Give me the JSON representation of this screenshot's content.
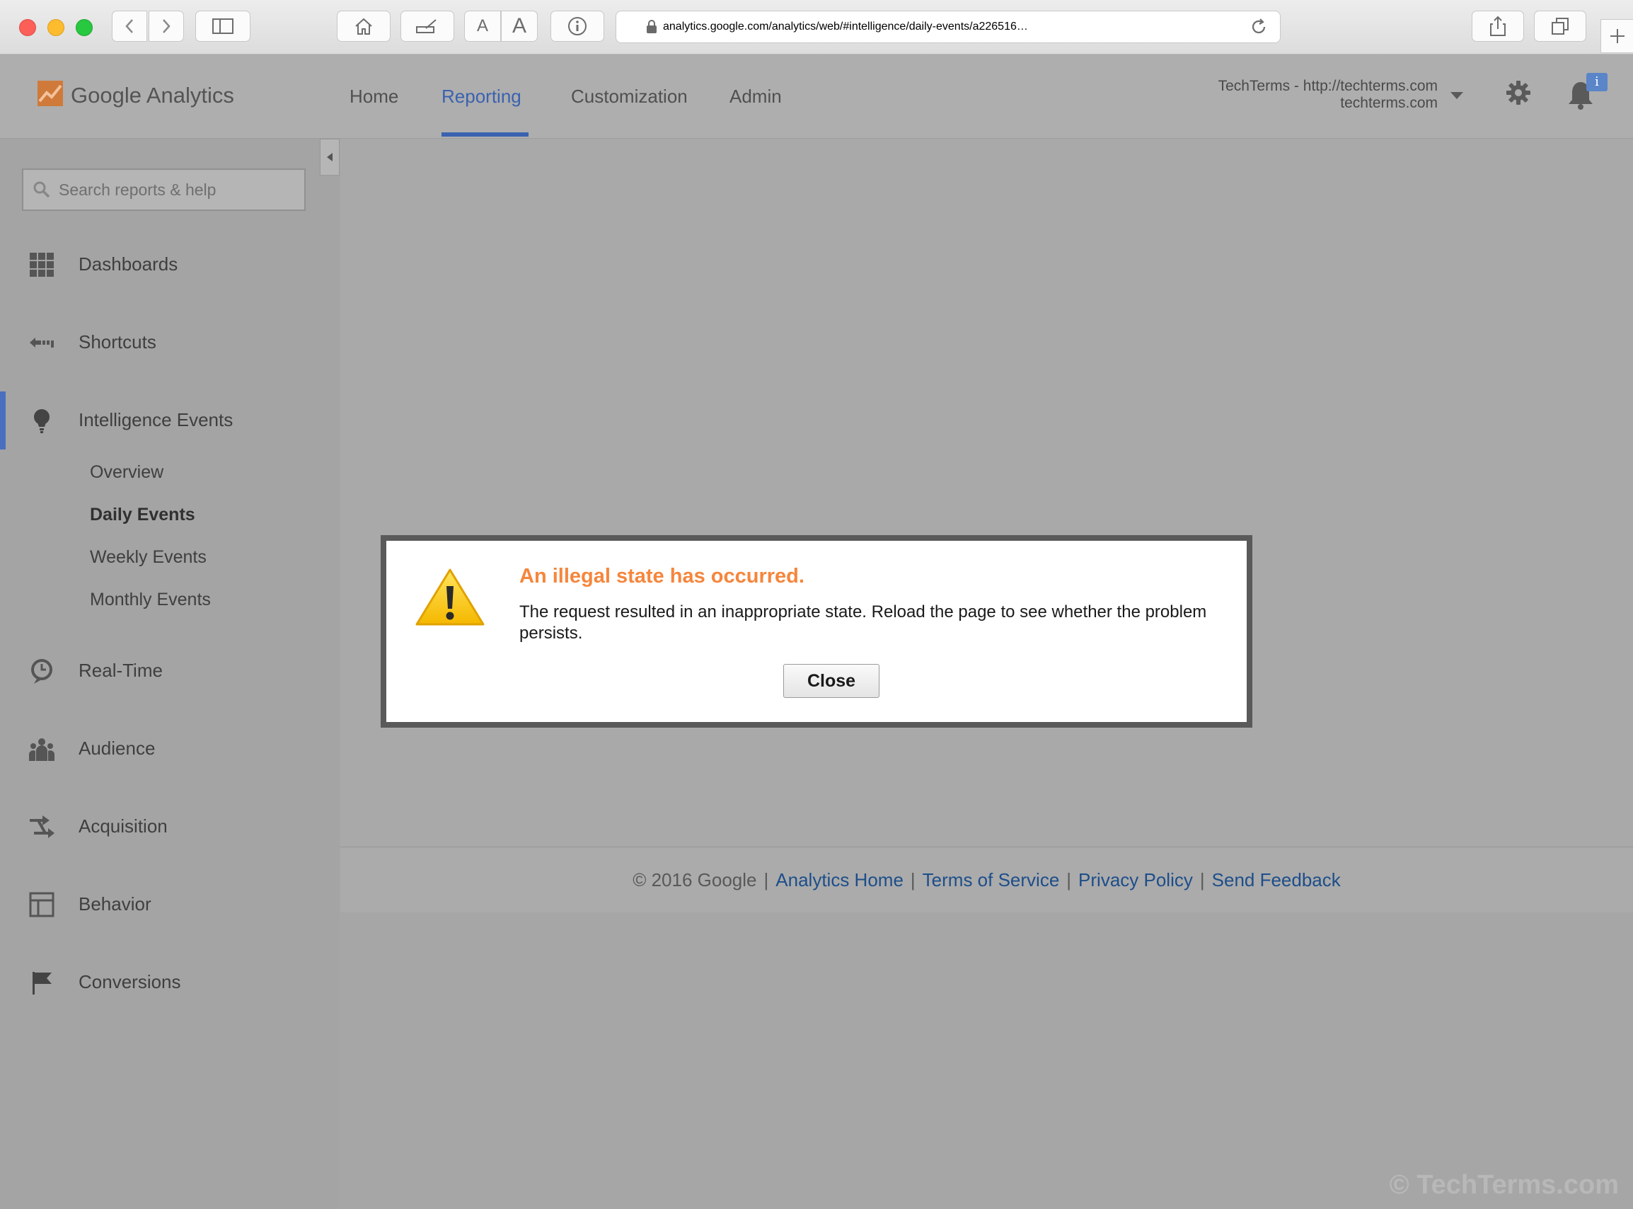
{
  "browser": {
    "url_domain": "analytics.google.com",
    "url_path": "/analytics/web/#intelligence/daily-events/a226516…",
    "font_small_label": "A",
    "font_large_label": "A"
  },
  "header": {
    "logo_text": "Google Analytics",
    "tabs": [
      {
        "label": "Home"
      },
      {
        "label": "Reporting",
        "active": true
      },
      {
        "label": "Customization"
      },
      {
        "label": "Admin"
      }
    ],
    "account_name": "TechTerms - http://techterms.com",
    "account_sub": "techterms.com",
    "notification_badge": "i",
    "accent_color": "#3a62b0"
  },
  "sidebar": {
    "search_placeholder": "Search reports & help",
    "items": [
      {
        "label": "Dashboards",
        "icon": "grid-icon"
      },
      {
        "label": "Shortcuts",
        "icon": "shortcut-arrow-icon"
      },
      {
        "label": "Intelligence Events",
        "icon": "lightbulb-icon",
        "active": true
      },
      {
        "label": "Real-Time",
        "icon": "clock-icon"
      },
      {
        "label": "Audience",
        "icon": "people-icon"
      },
      {
        "label": "Acquisition",
        "icon": "arrows-icon"
      },
      {
        "label": "Behavior",
        "icon": "layout-icon"
      },
      {
        "label": "Conversions",
        "icon": "flag-icon"
      }
    ],
    "sub_items": [
      {
        "label": "Overview"
      },
      {
        "label": "Daily Events",
        "active": true
      },
      {
        "label": "Weekly Events"
      },
      {
        "label": "Monthly Events"
      }
    ]
  },
  "dialog": {
    "title": "An illegal state has occurred.",
    "message": "The request resulted in an inappropriate state. Reload the page to see whether the problem persists.",
    "close_label": "Close",
    "title_color": "#f5863c"
  },
  "footer": {
    "copyright": "© 2016 Google",
    "separator": "|",
    "links": [
      "Analytics Home",
      "Terms of Service",
      "Privacy Policy",
      "Send Feedback"
    ]
  },
  "watermark": "© TechTerms.com"
}
